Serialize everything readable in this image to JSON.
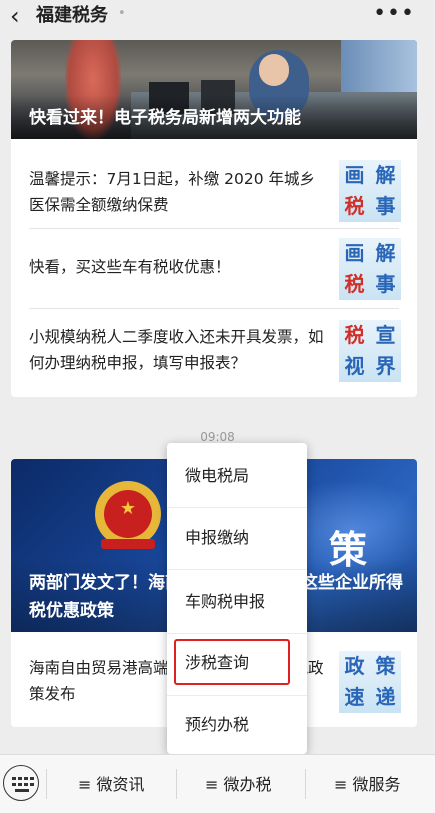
{
  "header": {
    "back_icon": "chevron-left-icon",
    "title": "福建税务",
    "more_icon": "more-dots-icon"
  },
  "card1": {
    "hero_caption": "快看过来！电子税务局新增两大功能",
    "items": [
      {
        "text": "温馨提示：7月1日起，补缴 2020 年城乡医保需全额缴纳保费",
        "thumb": [
          "画",
          "解",
          "税",
          "事"
        ]
      },
      {
        "text": "快看，买这些车有税收优惠！",
        "thumb": [
          "画",
          "解",
          "税",
          "事"
        ]
      },
      {
        "text": "小规模纳税人二季度收入还未开具发票，如何办理纳税申报，填写申报表？",
        "thumb": [
          "税",
          "宣",
          "视",
          "界"
        ]
      }
    ]
  },
  "timestamp": "09:08",
  "card2": {
    "hero_big": "策",
    "hero_caption": "两部门发文了！海南自由贸易港享受这些企业所得税优惠政策",
    "item": {
      "text": "海南自由贸易港高端紧缺人才个人所得税政策发布",
      "thumb": [
        "政",
        "策",
        "速",
        "递"
      ]
    }
  },
  "popup_menu": {
    "items": [
      "微电税局",
      "申报缴纳",
      "车购税申报",
      "涉税查询",
      "预约办税"
    ],
    "highlighted": "涉税查询",
    "highlight_color": "#e02020"
  },
  "bottom_bar": {
    "keyboard_icon": "keyboard-icon",
    "tabs": [
      "≡ 微资讯",
      "≡ 微办税",
      "≡ 微服务"
    ]
  }
}
